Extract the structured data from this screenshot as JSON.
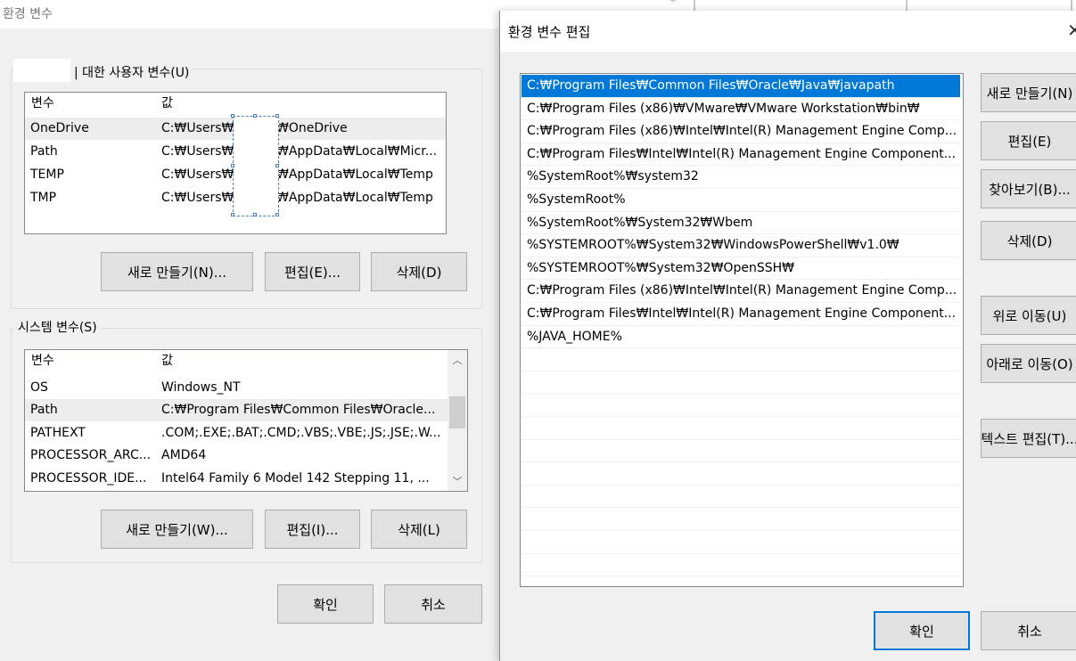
{
  "env_window": {
    "title": "환경 변수",
    "user_group_label": "| 대한 사용자 변수(U)",
    "columns": [
      "변수",
      "값"
    ],
    "user_vars": [
      {
        "name": "OneDrive",
        "value_prefix": "C:₩Users₩",
        "value_suffix": "₩OneDrive"
      },
      {
        "name": "Path",
        "value_prefix": "C:₩Users₩",
        "value_suffix": "₩AppData₩Local₩Micr..."
      },
      {
        "name": "TEMP",
        "value_prefix": "C:₩Users₩",
        "value_suffix": "₩AppData₩Local₩Temp"
      },
      {
        "name": "TMP",
        "value_prefix": "C:₩Users₩",
        "value_suffix": "₩AppData₩Local₩Temp"
      }
    ],
    "user_buttons": {
      "new": "새로 만들기(N)...",
      "edit": "편집(E)...",
      "delete": "삭제(D)"
    },
    "system_group_label": "시스템 변수(S)",
    "system_vars": [
      {
        "name": "OS",
        "value": "Windows_NT"
      },
      {
        "name": "Path",
        "value": "C:₩Program Files₩Common Files₩Oracle..."
      },
      {
        "name": "PATHEXT",
        "value": ".COM;.EXE;.BAT;.CMD;.VBS;.VBE;.JS;.JSE;.W..."
      },
      {
        "name": "PROCESSOR_ARC...",
        "value": "AMD64"
      },
      {
        "name": "PROCESSOR_IDE...",
        "value": "Intel64 Family 6 Model 142 Stepping 11, ..."
      }
    ],
    "system_buttons": {
      "new": "새로 만들기(W)...",
      "edit": "편집(I)...",
      "delete": "삭제(L)"
    },
    "ok": "확인",
    "cancel": "취소"
  },
  "edit_dialog": {
    "title": "환경 변수 편집",
    "paths": [
      "C:₩Program Files₩Common Files₩Oracle₩Java₩javapath",
      "C:₩Program Files (x86)₩VMware₩VMware Workstation₩bin₩",
      "C:₩Program Files (x86)₩Intel₩Intel(R) Management Engine Comp...",
      "C:₩Program Files₩Intel₩Intel(R) Management Engine Component...",
      "%SystemRoot%₩system32",
      "%SystemRoot%",
      "%SystemRoot%₩System32₩Wbem",
      "%SYSTEMROOT%₩System32₩WindowsPowerShell₩v1.0₩",
      "%SYSTEMROOT%₩System32₩OpenSSH₩",
      "C:₩Program Files (x86)₩Intel₩Intel(R) Management Engine Comp...",
      "C:₩Program Files₩Intel₩Intel(R) Management Engine Component...",
      "%JAVA_HOME%"
    ],
    "buttons": {
      "new": "새로 만들기(N)",
      "edit": "편집(E)",
      "browse": "찾아보기(B)...",
      "delete": "삭제(D)",
      "move_up": "위로 이동(U)",
      "move_down": "아래로 이동(O)",
      "edit_text": "텍스트 편집(T)...",
      "ok": "확인",
      "cancel": "취소"
    }
  },
  "colors": {
    "selection_blue": "#0078d7",
    "window_bg": "#f0f0f0",
    "button_bg": "#e1e1e1"
  }
}
